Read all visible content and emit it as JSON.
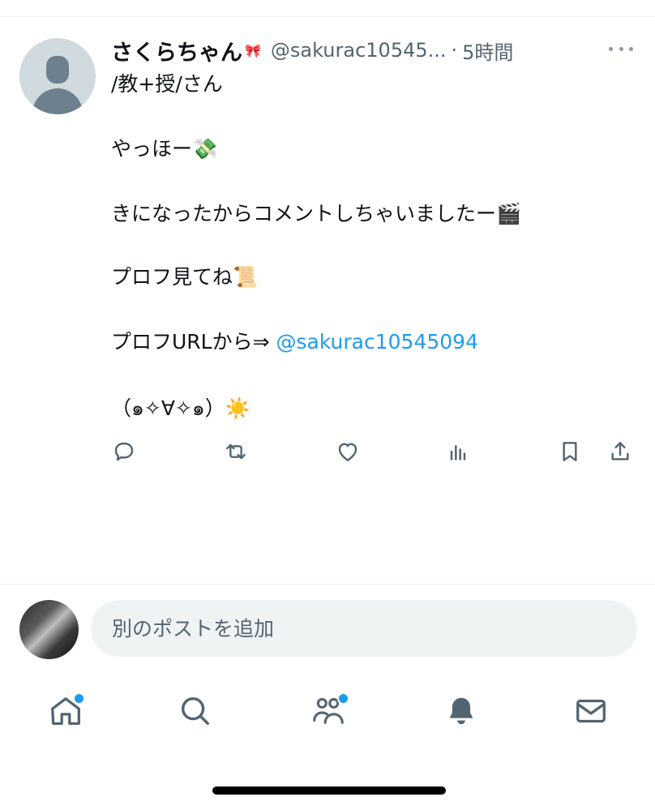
{
  "post": {
    "display_name": "さくらちゃん",
    "name_emoji": "🎀",
    "handle": "@sakurac10545...",
    "separator": "·",
    "time": "5時間",
    "lines": {
      "l1": "/教+授/さん",
      "l2": "やっほー💸",
      "l3": "きになったからコメントしちゃいましたー🎬",
      "l4": "プロフ見てね📜",
      "l5_prefix": "プロフURLから⇒ ",
      "l5_mention": "@sakurac10545094",
      "l6": "（๑✧∀✧๑）☀️"
    }
  },
  "actions": {
    "icons": [
      "reply-icon",
      "repost-icon",
      "like-icon",
      "views-icon",
      "bookmark-icon",
      "share-icon"
    ]
  },
  "compose": {
    "placeholder": "別のポストを追加"
  },
  "tabbar": {
    "items": [
      "home-icon",
      "search-icon",
      "communities-icon",
      "notifications-icon",
      "messages-icon"
    ],
    "badges": [
      "home",
      "communities"
    ]
  },
  "colors": {
    "accent": "#1d9bf0",
    "text": "#0f1419",
    "secondary": "#536471",
    "divider": "#eff3f4"
  }
}
